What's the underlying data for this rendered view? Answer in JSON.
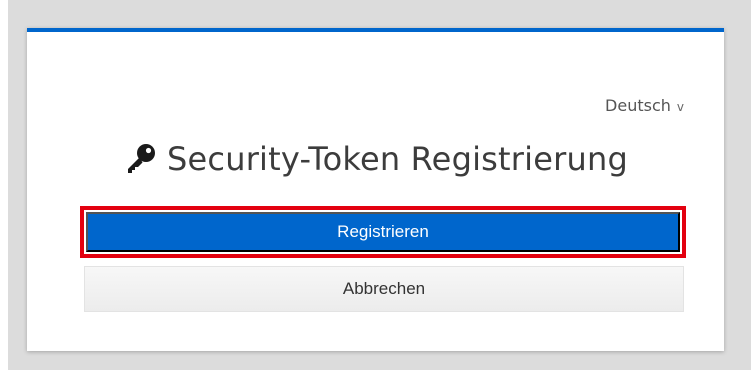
{
  "language": {
    "selected": "Deutsch",
    "chevron": "v"
  },
  "header": {
    "title": "Security-Token Registrierung",
    "icon": "key-icon"
  },
  "actions": {
    "register_label": "Registrieren",
    "cancel_label": "Abbrechen"
  },
  "colors": {
    "primary": "#0066cc",
    "highlight": "#e3000f",
    "text": "#3c3c3c",
    "secondary_bg": "#f2f2f2"
  }
}
